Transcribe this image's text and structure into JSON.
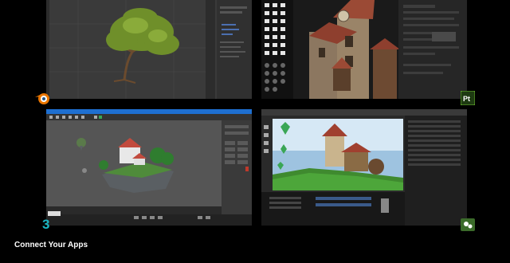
{
  "caption": "Connect Your Apps",
  "apps": {
    "top_left": {
      "icon": "blender-icon",
      "accent": "#ea7600"
    },
    "top_right": {
      "icon": "substance-painter-icon",
      "label": "Pt",
      "accent": "#6dbf2f"
    },
    "bottom_left": {
      "icon": "3ds-max-icon",
      "label": "3",
      "accent": "#19b6c2"
    },
    "bottom_right": {
      "icon": "unreal-bridge-icon",
      "accent": "#6ab04c"
    }
  }
}
